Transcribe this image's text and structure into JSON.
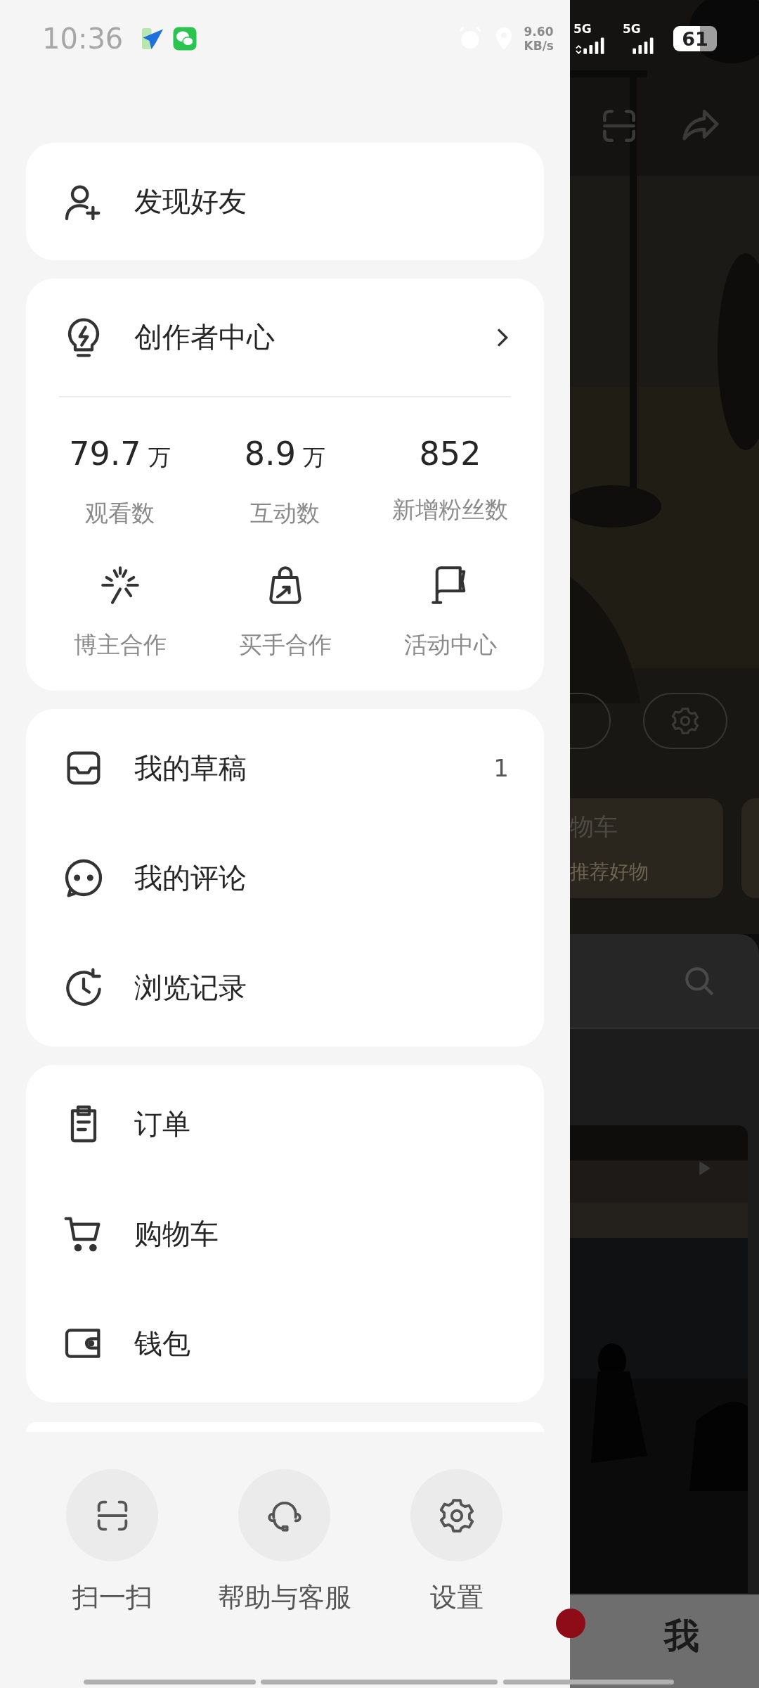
{
  "status_bar": {
    "time": "10:36",
    "speed_value": "9.60",
    "speed_unit": "KB/s",
    "sim_1": "5G",
    "sim_2": "5G",
    "battery": "61"
  },
  "drawer": {
    "find_friends": {
      "label": "发现好友"
    },
    "creator_center": {
      "title": "创作者中心",
      "stats": [
        {
          "value": "79.7",
          "unit": "万",
          "label": "观看数"
        },
        {
          "value": "8.9",
          "unit": "万",
          "label": "互动数"
        },
        {
          "value": "852",
          "label": "新增粉丝数"
        }
      ],
      "tools": [
        {
          "kind": "sparkle",
          "label": "博主合作"
        },
        {
          "kind": "bag",
          "label": "买手合作"
        },
        {
          "kind": "flag",
          "label": "活动中心"
        }
      ]
    },
    "menu_groups": [
      [
        {
          "kind": "drafts",
          "label": "我的草稿",
          "count": "1"
        },
        {
          "kind": "comments",
          "label": "我的评论"
        },
        {
          "kind": "history",
          "label": "浏览记录"
        }
      ],
      [
        {
          "kind": "orders",
          "label": "订单"
        },
        {
          "kind": "cart",
          "label": "购物车"
        },
        {
          "kind": "wallet",
          "label": "钱包"
        }
      ]
    ],
    "bottom_actions": [
      {
        "kind": "scan",
        "label": "扫一扫"
      },
      {
        "kind": "help",
        "label": "帮助与客服"
      },
      {
        "kind": "settings",
        "label": "设置"
      }
    ]
  },
  "background": {
    "cart_card": {
      "title": "物车",
      "subtitle": "推荐好物"
    },
    "tab_label": "我"
  }
}
